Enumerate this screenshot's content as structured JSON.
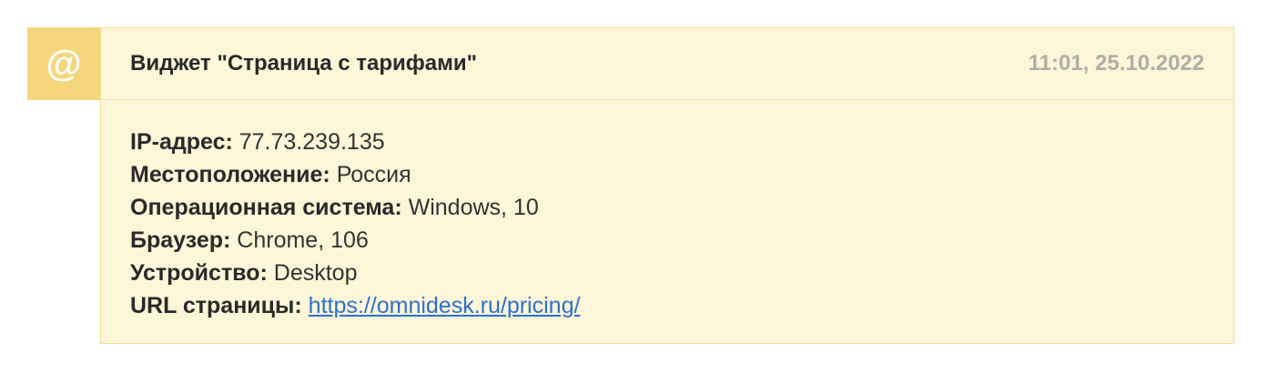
{
  "event": {
    "icon": "at-sign-icon",
    "icon_glyph": "@",
    "title": "Виджет \"Страница с тарифами\"",
    "time": "11:01, 25.10.2022",
    "colors": {
      "icon_bg": "#f5d67c",
      "card_bg": "#fdf6d8",
      "card_border": "#f2df93",
      "link": "#2f6fd1"
    },
    "fields": {
      "ip": {
        "label": "IP-адрес:",
        "value": "77.73.239.135"
      },
      "location": {
        "label": "Местоположение:",
        "value": "Россия"
      },
      "os": {
        "label": "Операционная система:",
        "value": "Windows, 10"
      },
      "browser": {
        "label": "Браузер:",
        "value": "Chrome, 106"
      },
      "device": {
        "label": "Устройство:",
        "value": "Desktop"
      },
      "url": {
        "label": "URL страницы:",
        "value": "https://omnidesk.ru/pricing/"
      }
    }
  }
}
